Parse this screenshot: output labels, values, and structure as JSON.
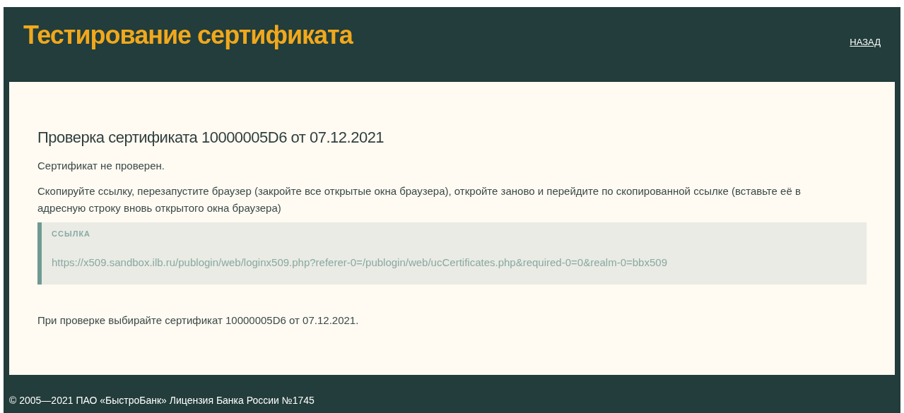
{
  "header": {
    "title": "Тестирование сертификата",
    "back_link": "НАЗАД"
  },
  "content": {
    "heading": "Проверка сертификата 10000005D6 от 07.12.2021",
    "status": "Сертификат не проверен.",
    "instructions": "Скопируйте ссылку, перезапустите браузер (закройте все открытые окна браузера), откройте заново и перейдите по скопированной ссылке (вставьте её в адресную строку вновь открытого окна браузера)",
    "link_box": {
      "label": "ССЫЛКА",
      "url": "https://x509.sandbox.ilb.ru/publogin/web/loginx509.php?referer-0=/publogin/web/ucCertificates.php&required-0=0&realm-0=bbx509"
    },
    "note": "При проверке выбирайте сертификат 10000005D6 от 07.12.2021."
  },
  "footer": {
    "copyright": "© 2005—2021 ПАО «БыстроБанк» Лицензия Банка России №1745"
  }
}
